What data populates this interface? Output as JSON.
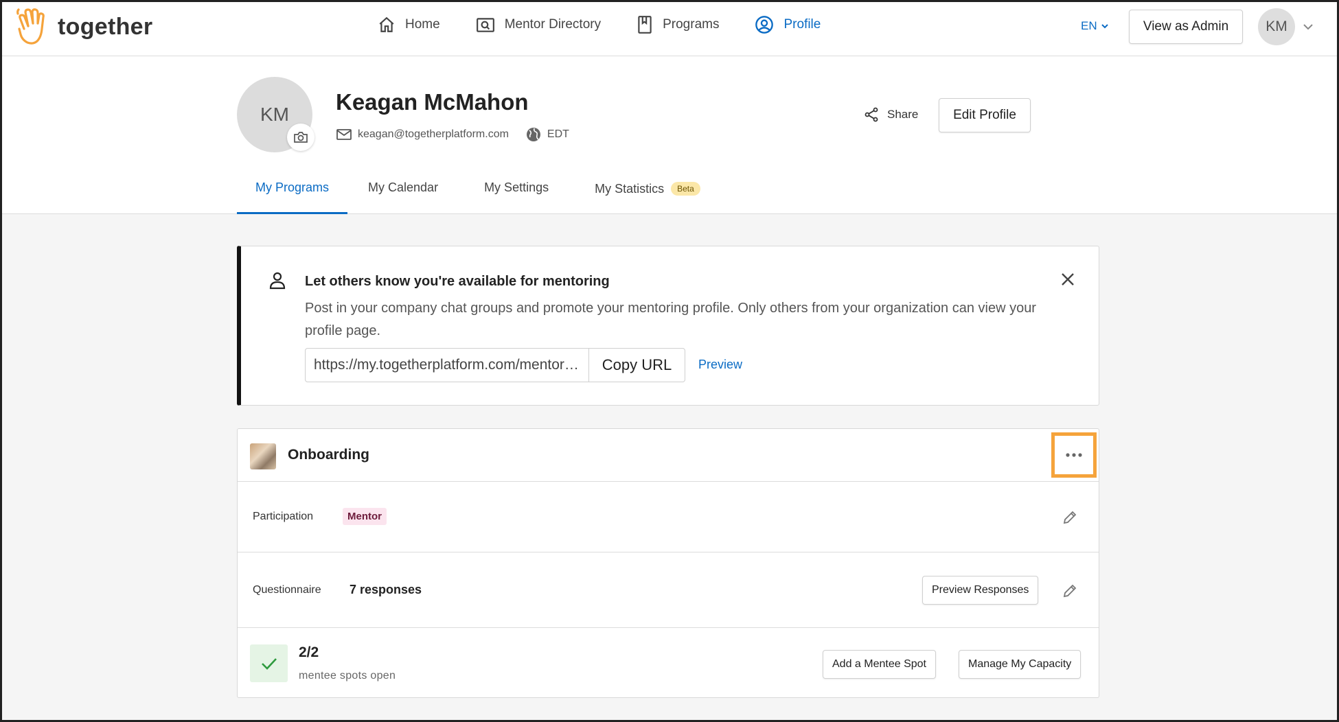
{
  "brand": {
    "name": "together",
    "accent": "#0a6bc4",
    "logo_color": "#f5a33b"
  },
  "nav": {
    "items": [
      {
        "label": "Home",
        "icon": "home-icon",
        "active": false
      },
      {
        "label": "Mentor Directory",
        "icon": "directory-icon",
        "active": false
      },
      {
        "label": "Programs",
        "icon": "bookmark-icon",
        "active": false
      },
      {
        "label": "Profile",
        "icon": "user-circle-icon",
        "active": true
      }
    ],
    "language": "EN",
    "view_as_admin": "View as Admin",
    "avatar_initials": "KM"
  },
  "profile": {
    "initials": "KM",
    "name": "Keagan McMahon",
    "email": "keagan@togetherplatform.com",
    "timezone": "EDT",
    "share_label": "Share",
    "edit_label": "Edit Profile"
  },
  "tabs": [
    {
      "label": "My Programs",
      "active": true
    },
    {
      "label": "My Calendar",
      "active": false
    },
    {
      "label": "My Settings",
      "active": false
    },
    {
      "label": "My Statistics",
      "active": false,
      "badge": "Beta"
    }
  ],
  "promo": {
    "title": "Let others know you're available for mentoring",
    "body": "Post in your company chat groups and promote your mentoring profile. Only others from your organization can view your profile page.",
    "url": "https://my.togetherplatform.com/mentors/keagan-mcmahon",
    "copy_label": "Copy URL",
    "preview_label": "Preview"
  },
  "program": {
    "name": "Onboarding",
    "participation_label": "Participation",
    "role": "Mentor",
    "questionnaire_label": "Questionnaire",
    "responses": "7 responses",
    "preview_responses": "Preview Responses",
    "spots": "2/2",
    "spots_label": "mentee spots open",
    "add_spot": "Add a Mentee Spot",
    "manage_capacity": "Manage My Capacity"
  }
}
